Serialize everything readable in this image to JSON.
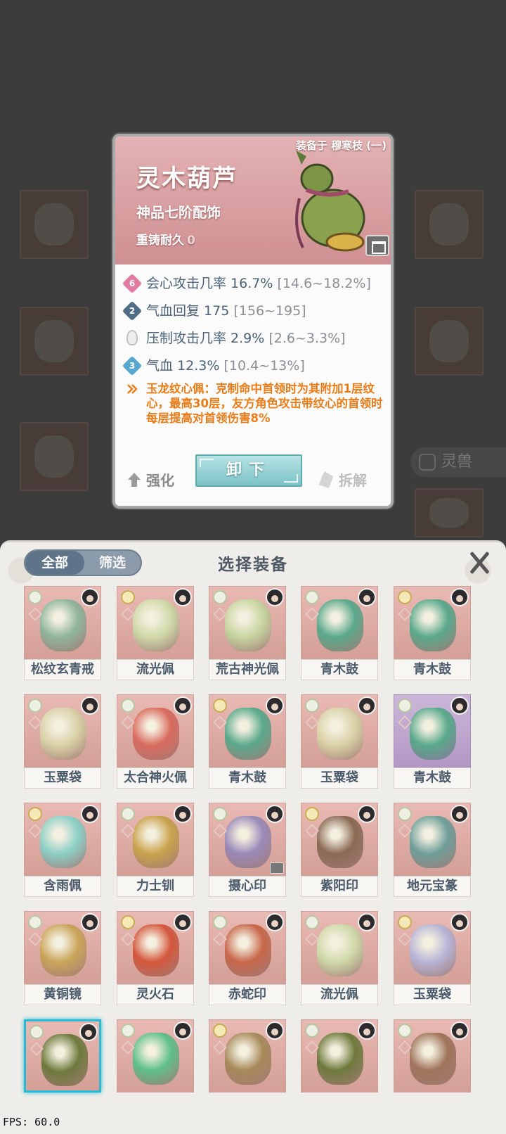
{
  "background": {
    "side_button_label": "灵兽"
  },
  "detail": {
    "equipped_by": "装备于 穆寒枝 (一)",
    "name": "灵木葫芦",
    "grade": "神品七阶配饰",
    "recast_label": "重铸耐久",
    "recast_value": "0",
    "stats": [
      {
        "badge": "6",
        "badge_color": "#e07aa0",
        "text": "会心攻击几率 16.7%",
        "range": "[14.6~18.2%]"
      },
      {
        "badge": "2",
        "badge_color": "#4e6c86",
        "text": "气血回复 175",
        "range": "[156~195]"
      },
      {
        "badge": "",
        "badge_color": "",
        "text": "压制攻击几率 2.9%",
        "range": "[2.6~3.3%]"
      },
      {
        "badge": "3",
        "badge_color": "#58a7cf",
        "text": "气血 12.3%",
        "range": "[10.4~13%]"
      }
    ],
    "effect": "玉龙纹心佩：克制命中首领时为其附加1层纹心，最高30层，友方角色攻击带纹心的首领时每层提高对首领伤害8%",
    "buttons": {
      "upgrade": "强化",
      "unequip": "卸下",
      "dismantle": "拆解"
    }
  },
  "panel": {
    "title": "选择装备",
    "tabs": {
      "all": "全部",
      "filter": "筛选"
    },
    "items": [
      {
        "name": "松纹玄青戒",
        "color": "#8fb59a"
      },
      {
        "name": "流光佩",
        "color": "#cfd9a8"
      },
      {
        "name": "荒古神光佩",
        "color": "#c7d5a0"
      },
      {
        "name": "青木鼓",
        "color": "#5aa98c"
      },
      {
        "name": "青木鼓",
        "color": "#5aa98c"
      },
      {
        "name": "玉粟袋",
        "color": "#d9d1a6"
      },
      {
        "name": "太合神火佩",
        "color": "#d96a5e"
      },
      {
        "name": "青木鼓",
        "color": "#5aa98c"
      },
      {
        "name": "玉粟袋",
        "color": "#d9d1a6"
      },
      {
        "name": "青木鼓",
        "color": "#5aa98c",
        "bg": "purple"
      },
      {
        "name": "含雨佩",
        "color": "#8ccfc6"
      },
      {
        "name": "力士钏",
        "color": "#c9a24c"
      },
      {
        "name": "摄心印",
        "color": "#9a8ab8",
        "locked": true
      },
      {
        "name": "紫阳印",
        "color": "#8a6a54"
      },
      {
        "name": "地元宝篆",
        "color": "#6f9f9a"
      },
      {
        "name": "黄铜镜",
        "color": "#caa55a"
      },
      {
        "name": "灵火石",
        "color": "#d4573c"
      },
      {
        "name": "赤蛇印",
        "color": "#c8674a"
      },
      {
        "name": "流光佩",
        "color": "#cfd9a8"
      },
      {
        "name": "玉粟袋",
        "color": "#b7b4d6"
      },
      {
        "name": "",
        "color": "#6e7a3c",
        "selected": true
      },
      {
        "name": "",
        "color": "#5fbf8a"
      },
      {
        "name": "",
        "color": "#a78a5a"
      },
      {
        "name": "",
        "color": "#6e7a3c"
      },
      {
        "name": "",
        "color": "#a0745a"
      }
    ]
  },
  "fps": "FPS: 60.0"
}
